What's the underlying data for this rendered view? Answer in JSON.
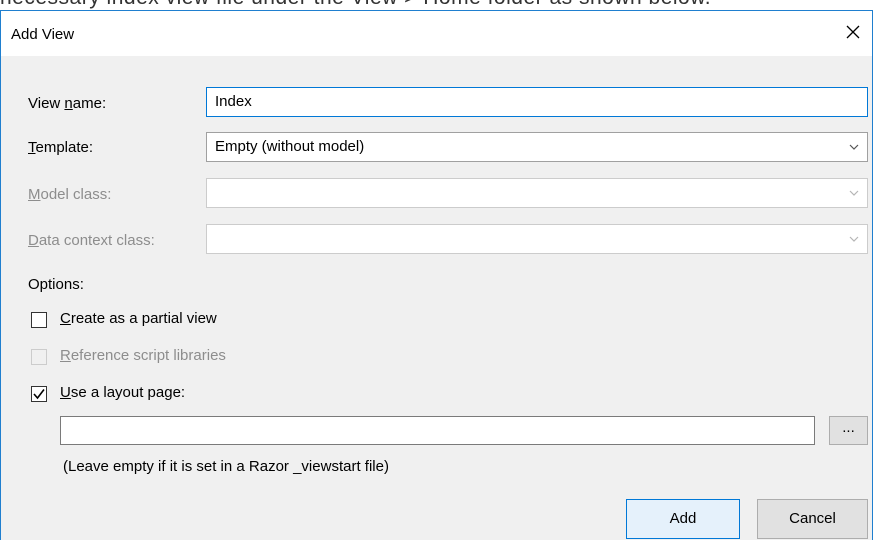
{
  "background_caption": "necessary index view file under the View > Home folder as shown below.",
  "dialog": {
    "title": "Add View",
    "close_glyph": "✕"
  },
  "fields": {
    "view_name": {
      "label_pre": "View ",
      "label_key": "n",
      "label_post": "ame:",
      "value": "Index"
    },
    "template": {
      "label_pre": "",
      "label_key": "T",
      "label_post": "emplate:",
      "value": "Empty (without model)"
    },
    "model_class": {
      "label_pre": "",
      "label_key": "M",
      "label_post": "odel class:",
      "value": ""
    },
    "data_context_class": {
      "label_pre": "",
      "label_key": "D",
      "label_post": "ata context class:",
      "value": ""
    }
  },
  "options": {
    "heading": "Options:",
    "partial_view": {
      "key": "C",
      "rest": "reate as a partial view",
      "checked": false,
      "enabled": true
    },
    "script_libraries": {
      "key": "R",
      "rest": "eference script libraries",
      "checked": false,
      "enabled": false
    },
    "layout_page": {
      "key": "U",
      "rest": "se a layout page:",
      "checked": true,
      "enabled": true
    },
    "layout_path": "",
    "browse_label": "...",
    "hint": "(Leave empty if it is set in a Razor _viewstart file)"
  },
  "buttons": {
    "add": "Add",
    "cancel": "Cancel"
  },
  "colors": {
    "accent": "#0078d7",
    "window_border": "#1f7fcf",
    "client_bg": "#f0f0f0",
    "disabled_text": "#8d8d8d"
  }
}
